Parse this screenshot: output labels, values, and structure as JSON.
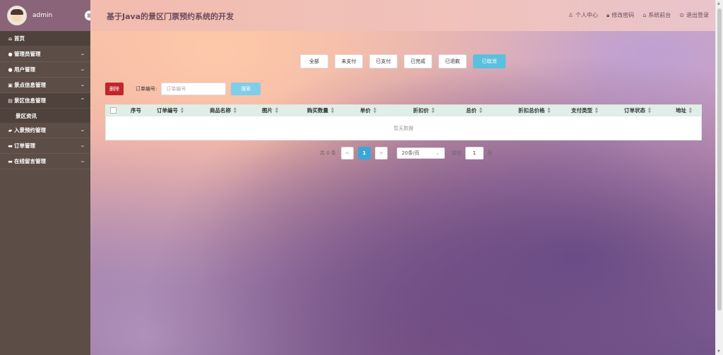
{
  "sidebar": {
    "admin_name": "admin",
    "items": [
      {
        "label": "首页",
        "icon": "home-icon"
      },
      {
        "label": "管理员管理",
        "icon": "user-circle-icon"
      },
      {
        "label": "用户管理",
        "icon": "person-icon"
      },
      {
        "label": "景点信息管理",
        "icon": "image-icon"
      },
      {
        "label": "景区信息管理",
        "icon": "table-icon"
      },
      {
        "label": "景区资讯",
        "icon": ""
      },
      {
        "label": "入景预约管理",
        "icon": "car-icon"
      },
      {
        "label": "订单管理",
        "icon": "folder-icon"
      },
      {
        "label": "在线留言管理",
        "icon": "message-icon"
      }
    ]
  },
  "header": {
    "title": "基于Java的景区门票预约系统的开发",
    "links": [
      {
        "label": "个人中心",
        "icon": "user-icon"
      },
      {
        "label": "修改密码",
        "icon": "lock-icon"
      },
      {
        "label": "系统前台",
        "icon": "home-icon"
      },
      {
        "label": "退出登录",
        "icon": "power-icon"
      }
    ]
  },
  "filters": {
    "items": [
      "全部",
      "未支付",
      "已支付",
      "已完成",
      "已退款",
      "已取消"
    ],
    "active_index": 5,
    "active_color": "#5bc0de"
  },
  "search": {
    "delete_label": "删除",
    "label": "订单编号:",
    "placeholder": "订单编号",
    "value": "",
    "button_label": "搜索"
  },
  "table": {
    "columns": [
      "序号",
      "订单编号",
      "商品名称",
      "图片",
      "购买数量",
      "单价",
      "折扣价",
      "总价",
      "折扣总价格",
      "支付类型",
      "订单状态",
      "地址"
    ],
    "empty_text": "暂无数据",
    "header_bg": "#dfeee6"
  },
  "pagination": {
    "total_text": "共 0 条",
    "prev": "<",
    "current_page": "1",
    "next": ">",
    "page_size": "20条/页",
    "goto_label": "前往",
    "goto_value": "1",
    "page_unit": "页"
  }
}
